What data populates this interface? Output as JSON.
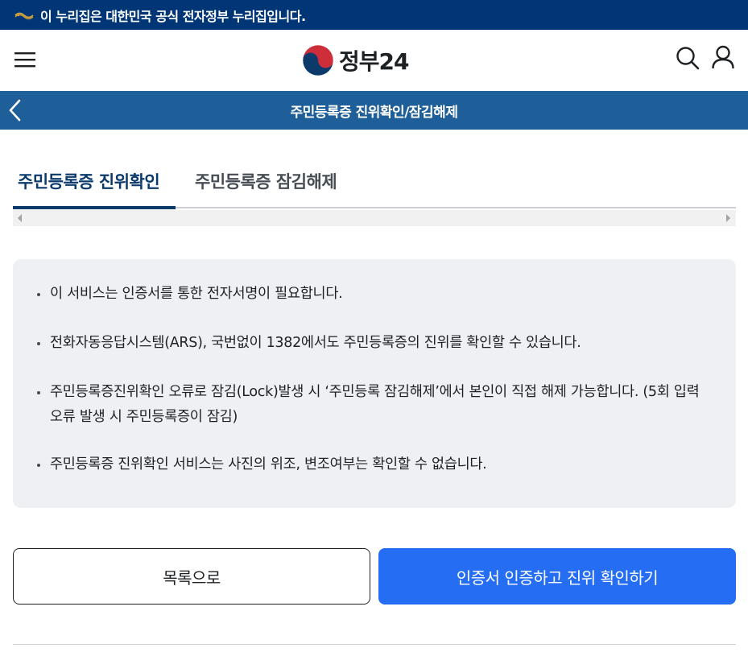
{
  "banner": {
    "text": "이 누리집은 대한민국 공식 전자정부 누리집입니다.",
    "icon": "taegeuk-flag-icon"
  },
  "header": {
    "logo_text": "정부24",
    "menu_icon": "hamburger-menu-icon",
    "search_icon": "search-icon",
    "user_icon": "user-icon"
  },
  "title_bar": {
    "title": "주민등록증 진위확인/잠김해제",
    "back_icon": "chevron-left-icon"
  },
  "tabs": [
    {
      "label": "주민등록증 진위확인",
      "active": true
    },
    {
      "label": "주민등록증 잠김해제",
      "active": false
    }
  ],
  "notices": [
    "이 서비스는 인증서를 통한 전자서명이 필요합니다.",
    "전화자동응답시스템(ARS), 국번없이 1382에서도 주민등록증의 진위를 확인할 수 있습니다.",
    "주민등록증진위확인 오류로 잠김(Lock)발생 시 ‘주민등록 잠김해제’에서 본인이 직접 해제 가능합니다. (5회 입력 오류 발생 시 주민등록증이 잠김)",
    "주민등록증 진위확인 서비스는 사진의 위조, 변조여부는 확인할 수 없습니다."
  ],
  "buttons": {
    "list_label": "목록으로",
    "verify_label": "인증서 인증하고 진위 확인하기"
  },
  "colors": {
    "banner_bg": "#003675",
    "title_bar_bg": "#1f5f99",
    "tab_active": "#0b3a6b",
    "notice_bg": "#eef0f4",
    "primary_button": "#256ef4"
  }
}
